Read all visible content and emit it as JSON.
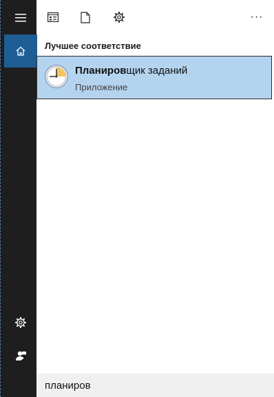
{
  "toolbar": {
    "apps_icon": "apps-filter-icon",
    "docs_icon": "document-icon",
    "settings_icon": "gear-icon",
    "more_label": "···"
  },
  "rail": {
    "menu_icon": "hamburger-icon",
    "home_icon": "home-icon",
    "settings_icon": "gear-icon",
    "feedback_icon": "feedback-icon"
  },
  "results": {
    "section_title": "Лучшее соответствие",
    "best_match": {
      "title_match": "Планиров",
      "title_rest": "щик заданий",
      "subtitle": "Приложение",
      "icon": "task-scheduler-clock-icon"
    }
  },
  "search": {
    "value": "планиров"
  },
  "colors": {
    "rail_bg": "#1e1e1e",
    "home_active": "#1f5e94",
    "selection_bg": "#b4d3ef",
    "search_bg": "#f0f0f0"
  }
}
